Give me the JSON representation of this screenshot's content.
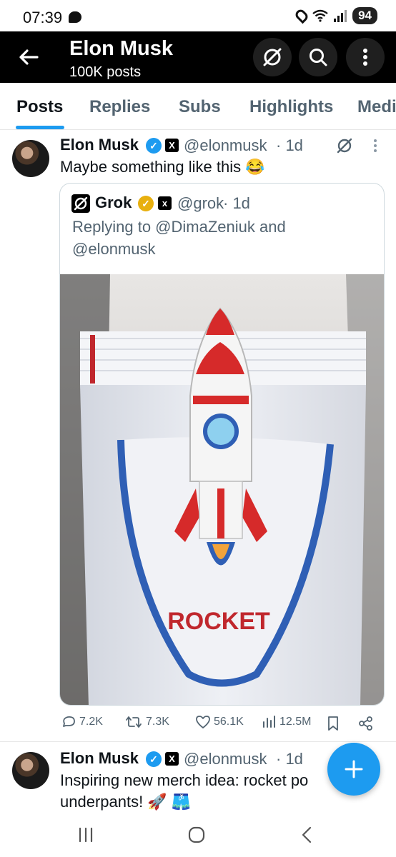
{
  "status_bar": {
    "time": "07:39",
    "battery": "94"
  },
  "header": {
    "title": "Elon Musk",
    "subtitle": "100K posts"
  },
  "tabs": [
    {
      "label": "Posts",
      "active": true
    },
    {
      "label": "Replies"
    },
    {
      "label": "Subs"
    },
    {
      "label": "Highlights"
    },
    {
      "label": "Medi"
    }
  ],
  "post": {
    "author": "Elon Musk",
    "handle": "@elonmusk",
    "time": "· 1d",
    "text": "Maybe something like this 😂",
    "quote": {
      "author": "Grok",
      "handle": "@grok",
      "time": "· 1d",
      "reply_line1": "Replying to @DimaZeniuk and",
      "reply_line2": "@elonmusk",
      "image_caption": "ROCKET"
    },
    "stats": {
      "replies": "7.2K",
      "reposts": "7.3K",
      "likes": "56.1K",
      "views": "12.5M"
    }
  },
  "post2": {
    "author": "Elon Musk",
    "handle": "@elonmusk",
    "time": "· 1d",
    "text_line1": "Inspiring new merch idea: rocket po",
    "text_line2": "underpants! 🚀 🩳"
  },
  "colors": {
    "accent": "#1d9bf0",
    "header_bg": "#000000",
    "muted_text": "#536471"
  },
  "icons": {
    "back": "arrow-left",
    "grok": "grok-slash-circle",
    "search": "magnifier",
    "more": "vertical-dots",
    "compose": "plus"
  }
}
